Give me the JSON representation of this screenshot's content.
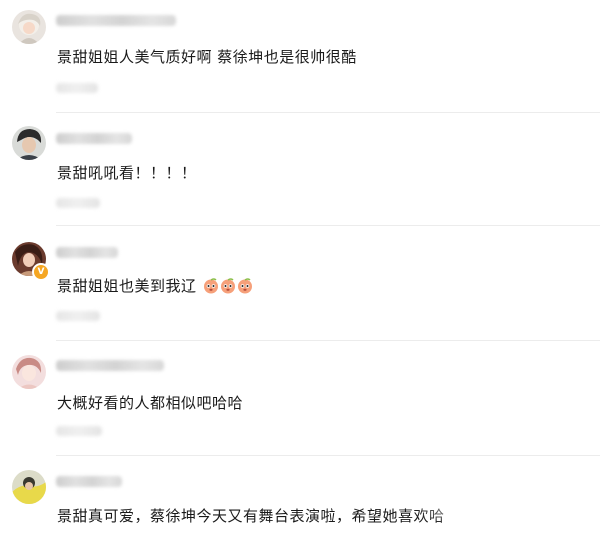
{
  "comments": [
    {
      "text": "景甜姐姐人美气质好啊 蔡徐坤也是很帅很酷",
      "avatar": "avatar-1",
      "emoji_count": 0
    },
    {
      "text": "景甜吼吼看！！！！",
      "avatar": "avatar-2",
      "emoji_count": 0
    },
    {
      "text": "景甜姐姐也美到我辽",
      "avatar": "avatar-3",
      "verified": true,
      "emoji": "peach-face-emoji",
      "emoji_count": 3
    },
    {
      "text": "大概好看的人都相似吧哈哈",
      "avatar": "avatar-4",
      "emoji_count": 0
    },
    {
      "text": "景甜真可爱，蔡徐坤今天又有舞台表演啦，希望她喜欢哈",
      "avatar": "avatar-5",
      "emoji_count": 0
    }
  ],
  "colors": {
    "text": "#1a1a1a",
    "divider": "#ececec",
    "verified_badge": "#f5a623"
  }
}
